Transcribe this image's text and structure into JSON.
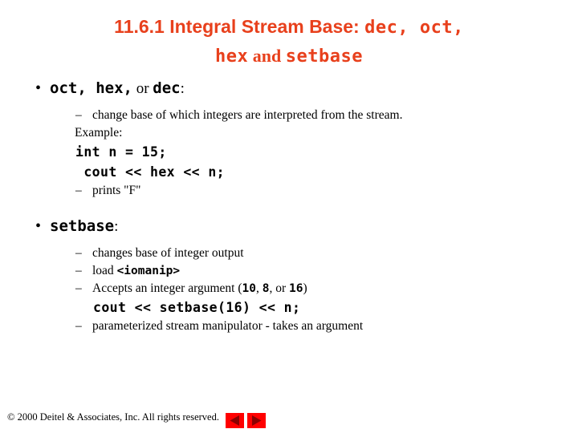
{
  "slide": {
    "title": {
      "prefix": "11.6.1  Integral Stream Base: ",
      "code1": "dec, oct,",
      "line2_code_a": "hex",
      "line2_and": " and ",
      "line2_code_b": "setbase",
      "color": "#E8401C"
    },
    "bullets": [
      {
        "marker": "•",
        "code_a": "oct, hex,",
        "mid": " or ",
        "code_b": "dec",
        "tail": ":",
        "children": [
          {
            "kind": "dash",
            "marker": "–",
            "text": "change base of which integers are interpreted from the stream."
          },
          {
            "kind": "plain",
            "text": "Example:"
          },
          {
            "kind": "code",
            "indent": "code-1",
            "text": "int n = 15;"
          },
          {
            "kind": "code",
            "indent": "code-2",
            "text": " cout << hex << n;"
          },
          {
            "kind": "dash",
            "marker": "–",
            "text": "prints \"F\""
          }
        ]
      },
      {
        "marker": "•",
        "code_a": "setbase",
        "mid": "",
        "code_b": "",
        "tail": ":",
        "children": [
          {
            "kind": "dash",
            "marker": "–",
            "text": "changes base of integer output"
          },
          {
            "kind": "dash-code",
            "marker": "–",
            "text": "load ",
            "code": "<iomanip>"
          },
          {
            "kind": "dash-args",
            "marker": "–",
            "pre": "Accepts an integer argument (",
            "n1": "10",
            "sep1": ", ",
            "n2": "8",
            "sep2": ", or ",
            "n3": "16",
            "post": ")"
          },
          {
            "kind": "code",
            "indent": "code-3",
            "text": "cout << setbase(16) << n;"
          },
          {
            "kind": "dash",
            "marker": "–",
            "text": "parameterized stream manipulator - takes an argument"
          }
        ]
      }
    ],
    "footer": {
      "copyright": "© 2000 Deitel & Associates, Inc.  All rights reserved.",
      "prev_label": "Previous slide",
      "next_label": "Next slide",
      "button_color": "#FF0000",
      "arrow_color": "#8B0000"
    }
  }
}
